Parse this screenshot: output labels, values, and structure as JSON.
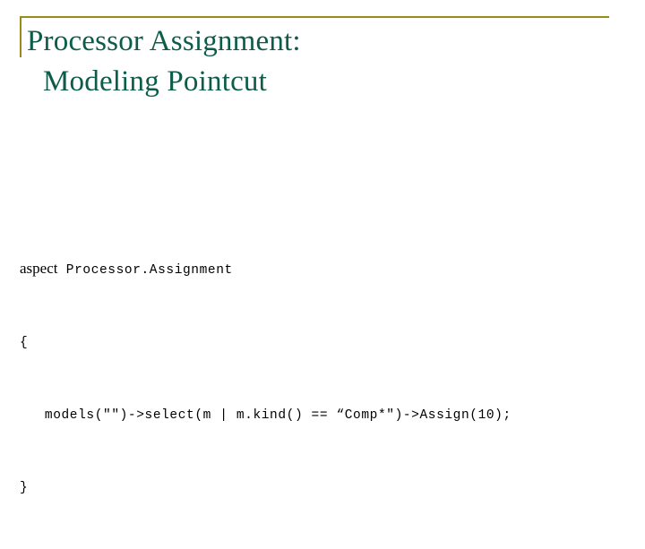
{
  "slide": {
    "title_line1": "Processor Assignment:",
    "title_line2": "Modeling Pointcut",
    "accent_color": "#9a8a17",
    "title_color": "#0d5c4a",
    "code": {
      "keyword": "aspect",
      "line1_rest": " Processor.Assignment",
      "line2": "{",
      "line3": "   models(\"\")->select(m | m.kind() == “Comp*\")->Assign(10);",
      "line4": "}"
    }
  }
}
